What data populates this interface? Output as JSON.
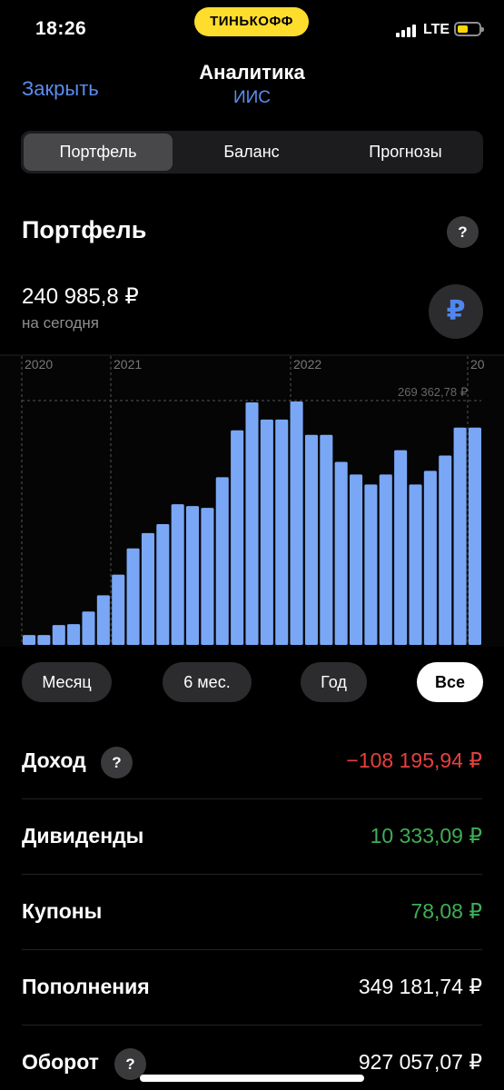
{
  "status": {
    "time": "18:26",
    "carrier": "ТИНЬКОФФ",
    "network": "LTE"
  },
  "nav": {
    "close_label": "Закрыть",
    "title": "Аналитика",
    "subtitle": "ИИС"
  },
  "tabs": [
    {
      "label": "Портфель",
      "active": true
    },
    {
      "label": "Баланс",
      "active": false
    },
    {
      "label": "Прогнозы",
      "active": false
    }
  ],
  "portfolio": {
    "title": "Портфель",
    "help": "?",
    "value": "240 985,8 ₽",
    "value_caption": "на сегодня",
    "currency_symbol": "₽"
  },
  "chart_data": {
    "type": "bar",
    "color": "#7aa7f5",
    "x_tick_labels": [
      "2020",
      "2021",
      "2022",
      "20"
    ],
    "max_label": "269 362,78 ₽",
    "values": [
      11000,
      11000,
      22000,
      23000,
      37000,
      55000,
      78000,
      107000,
      124000,
      134000,
      156000,
      154000,
      152000,
      186000,
      238000,
      269000,
      250000,
      250000,
      270000,
      233000,
      233000,
      203000,
      189000,
      178000,
      189000,
      216000,
      178000,
      193000,
      210000,
      241000,
      241000
    ]
  },
  "periods": [
    {
      "label": "Месяц",
      "active": false
    },
    {
      "label": "6 мес.",
      "active": false
    },
    {
      "label": "Год",
      "active": false
    },
    {
      "label": "Все",
      "active": true
    }
  ],
  "stats": [
    {
      "label": "Доход",
      "value": "−108 195,94 ₽",
      "tone": "negative",
      "help": "?"
    },
    {
      "label": "Дивиденды",
      "value": "10 333,09 ₽",
      "tone": "positive"
    },
    {
      "label": "Купоны",
      "value": "78,08 ₽",
      "tone": "positive"
    },
    {
      "label": "Пополнения",
      "value": "349 181,74 ₽",
      "tone": "neutral"
    },
    {
      "label": "Оборот",
      "value": "927 057,07 ₽",
      "tone": "neutral",
      "help": "?"
    }
  ],
  "colors": {
    "accent": "#5a8dee",
    "brand": "#ffdd2d",
    "negative": "#e5403f",
    "positive": "#3fae55"
  }
}
